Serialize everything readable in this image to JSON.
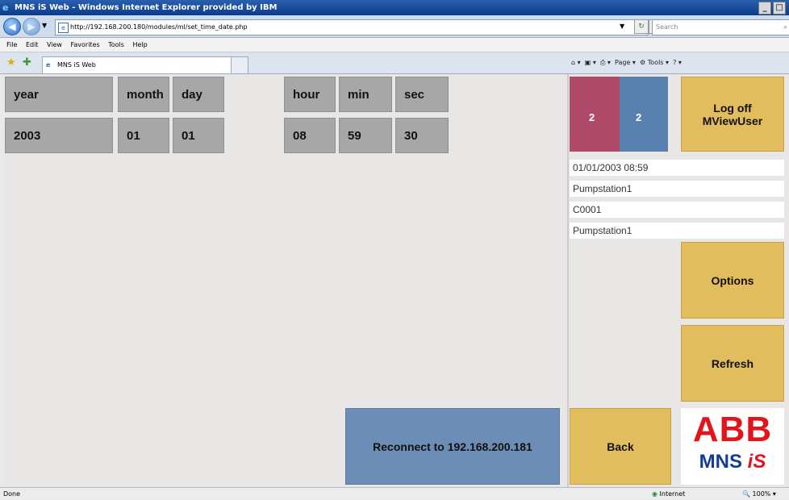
{
  "window": {
    "title": "MNS iS Web - Windows Internet Explorer provided by IBM"
  },
  "browser": {
    "url": "http://192.168.200.180/modules/ml/set_time_date.php",
    "search_placeholder": "Search",
    "menu": [
      "File",
      "Edit",
      "View",
      "Favorites",
      "Tools",
      "Help"
    ],
    "tab_title": "MNS iS Web",
    "toolbar": {
      "page": "Page",
      "tools": "Tools"
    },
    "status": "Done",
    "zone": "Internet",
    "zoom": "100%"
  },
  "datetime_editor": {
    "labels": {
      "year": "year",
      "month": "month",
      "day": "day",
      "hour": "hour",
      "min": "min",
      "sec": "sec"
    },
    "values": {
      "year": "2003",
      "month": "01",
      "day": "01",
      "hour": "08",
      "min": "59",
      "sec": "30"
    }
  },
  "reconnect_button": "Reconnect to 192.168.200.181",
  "side": {
    "counter_left": "2",
    "counter_right": "2",
    "logoff_line1": "Log off",
    "logoff_line2": "MViewUser",
    "datetime": "01/01/2003 08:59",
    "station": "Pumpstation1",
    "code": "C0001",
    "station2": "Pumpstation1",
    "options": "Options",
    "refresh": "Refresh",
    "back": "Back",
    "logo_top": "ABB",
    "logo_bottom_1": "MNS",
    "logo_bottom_2": "iS"
  },
  "colors": {
    "gold": "#e2bd5d",
    "gray": "#a7a7a7",
    "blue": "#6c8db6",
    "maroon": "#b04a6a",
    "steel": "#5a80b0",
    "abb_red": "#e3141b",
    "mns_blue": "#123a96"
  }
}
